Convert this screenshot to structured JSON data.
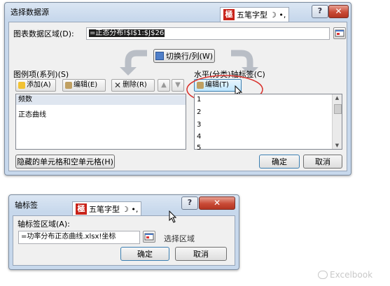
{
  "dialog1": {
    "title": "选择数据源",
    "ime": {
      "label": "五笔字型",
      "symbols": "☽ •,",
      "logo": "極"
    },
    "help_btn": "?",
    "close_btn": "✕",
    "range_label": "图表数据区域(D):",
    "range_value": "=正态分布!$I$1:$J$26",
    "switch_button": "切换行/列(W)",
    "legend_section": "图例项(系列)(S)",
    "legend_toolbar": {
      "add": "添加(A)",
      "edit": "编辑(E)",
      "remove": "删除(R)"
    },
    "series": [
      "频数",
      "正态曲线"
    ],
    "axis_section": "水平(分类)轴标签(C)",
    "axis_edit": "编辑(T)",
    "axis_items": [
      "1",
      "2",
      "3",
      "4",
      "5"
    ],
    "hidden_cells_btn": "隐藏的单元格和空单元格(H)",
    "ok": "确定",
    "cancel": "取消"
  },
  "dialog2": {
    "title": "轴标签",
    "ime": {
      "label": "五笔字型",
      "symbols": "☽ •,",
      "logo": "極"
    },
    "help_btn": "?",
    "close_btn": "✕",
    "range_label": "轴标签区域(A):",
    "range_value": "=功率分布正态曲线.xlsx!坐标",
    "select_range": "选择区域",
    "ok": "确定",
    "cancel": "取消"
  },
  "watermark": "Excelbook",
  "colors": {
    "highlight": "#d9302b",
    "title_bar": "#c7d8ec"
  }
}
